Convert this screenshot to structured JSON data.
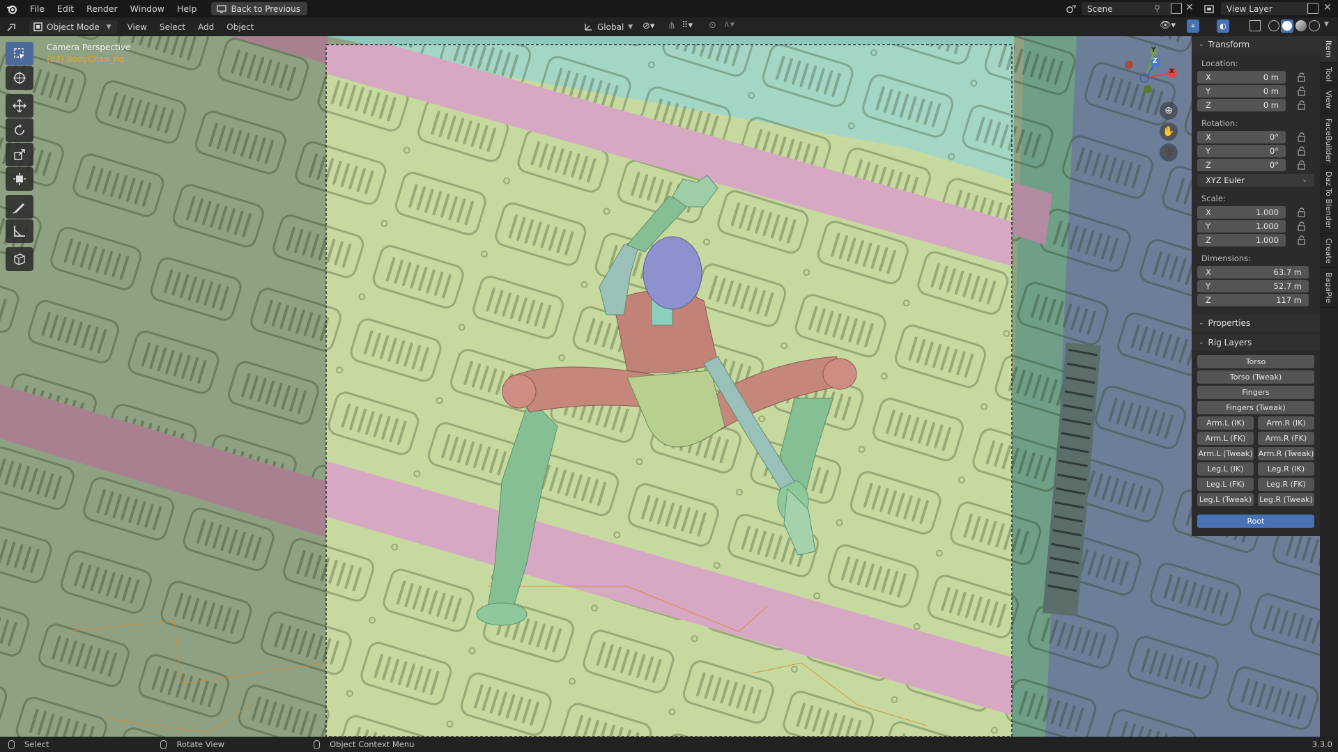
{
  "menubar": {
    "items": [
      "File",
      "Edit",
      "Render",
      "Window",
      "Help"
    ],
    "back_button": "Back to Previous",
    "scene": "Scene",
    "view_layer": "View Layer"
  },
  "header": {
    "mode": "Object Mode",
    "menus": [
      "View",
      "Select",
      "Add",
      "Object"
    ],
    "orientation": "Global"
  },
  "viewport": {
    "camera_label": "Camera Perspective",
    "object_label": "(32) BodyChan_rig",
    "gizmo_axes": {
      "x": "X",
      "y": "Y",
      "z": "Z"
    }
  },
  "toolbar": {
    "tools": [
      "select-box-icon",
      "cursor-icon",
      "move-icon",
      "rotate-icon",
      "scale-icon",
      "transform-icon",
      "annotate-icon",
      "measure-icon",
      "add-cube-icon"
    ]
  },
  "npanel": {
    "transform_title": "Transform",
    "location_label": "Location:",
    "location": [
      {
        "axis": "X",
        "value": "0 m"
      },
      {
        "axis": "Y",
        "value": "0 m"
      },
      {
        "axis": "Z",
        "value": "0 m"
      }
    ],
    "rotation_label": "Rotation:",
    "rotation": [
      {
        "axis": "X",
        "value": "0°"
      },
      {
        "axis": "Y",
        "value": "0°"
      },
      {
        "axis": "Z",
        "value": "0°"
      }
    ],
    "rotation_mode": "XYZ Euler",
    "scale_label": "Scale:",
    "scale": [
      {
        "axis": "X",
        "value": "1.000"
      },
      {
        "axis": "Y",
        "value": "1.000"
      },
      {
        "axis": "Z",
        "value": "1.000"
      }
    ],
    "dimensions_label": "Dimensions:",
    "dimensions": [
      {
        "axis": "X",
        "value": "63.7 m"
      },
      {
        "axis": "Y",
        "value": "52.7 m"
      },
      {
        "axis": "Z",
        "value": "117 m"
      }
    ],
    "properties_title": "Properties",
    "rig_layers_title": "Rig Layers",
    "rig_full": [
      "Torso",
      "Torso (Tweak)",
      "Fingers",
      "Fingers (Tweak)"
    ],
    "rig_pairs": [
      [
        "Arm.L (IK)",
        "Arm.R (IK)"
      ],
      [
        "Arm.L (FK)",
        "Arm.R (FK)"
      ],
      [
        "Arm.L (Tweak)",
        "Arm.R (Tweak)"
      ],
      [
        "Leg.L (IK)",
        "Leg.R (IK)"
      ],
      [
        "Leg.L (FK)",
        "Leg.R (FK)"
      ],
      [
        "Leg.L (Tweak)",
        "Leg.R (Tweak)"
      ]
    ],
    "root_button": "Root"
  },
  "side_tabs": [
    "Item",
    "Tool",
    "View",
    "FaceBuilder",
    "Daz To Blender",
    "Create",
    "BagaPie"
  ],
  "statusbar": {
    "select": "Select",
    "rotate": "Rotate View",
    "context": "Object Context Menu",
    "version": "3.3.0"
  },
  "colors": {
    "accent": "#4772b3",
    "panel_plate": "#c9dca2",
    "pink_stripe": "#d3a9c2",
    "teal_plate": "#9fd4c4",
    "body_green": "#8fc49a",
    "body_red": "#c2837a",
    "head": "#8d92cf"
  }
}
